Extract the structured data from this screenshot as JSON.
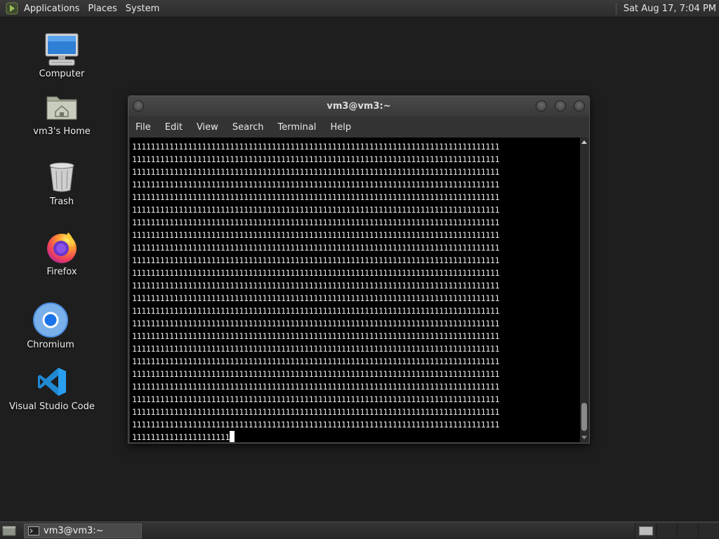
{
  "top_panel": {
    "menus": [
      "Applications",
      "Places",
      "System"
    ],
    "clock": "Sat Aug 17,  7:04 PM"
  },
  "desktop_icons": [
    {
      "label": "Computer",
      "icon": "computer-icon"
    },
    {
      "label": "vm3's Home",
      "icon": "home-folder-icon"
    },
    {
      "label": "Trash",
      "icon": "trash-icon"
    },
    {
      "label": "Firefox",
      "icon": "firefox-icon"
    },
    {
      "label": "Chromium",
      "icon": "chromium-icon"
    },
    {
      "label": "Visual Studio Code",
      "icon": "vscode-icon"
    }
  ],
  "terminal": {
    "title": "vm3@vm3:~",
    "menus": [
      "File",
      "Edit",
      "View",
      "Search",
      "Terminal",
      "Help"
    ],
    "output_lines": [
      "1111111111111111111111111111111111111111111111111111111111111111111111111111111",
      "1111111111111111111111111111111111111111111111111111111111111111111111111111111",
      "1111111111111111111111111111111111111111111111111111111111111111111111111111111",
      "1111111111111111111111111111111111111111111111111111111111111111111111111111111",
      "1111111111111111111111111111111111111111111111111111111111111111111111111111111",
      "1111111111111111111111111111111111111111111111111111111111111111111111111111111",
      "1111111111111111111111111111111111111111111111111111111111111111111111111111111",
      "1111111111111111111111111111111111111111111111111111111111111111111111111111111",
      "1111111111111111111111111111111111111111111111111111111111111111111111111111111",
      "1111111111111111111111111111111111111111111111111111111111111111111111111111111",
      "1111111111111111111111111111111111111111111111111111111111111111111111111111111",
      "1111111111111111111111111111111111111111111111111111111111111111111111111111111",
      "1111111111111111111111111111111111111111111111111111111111111111111111111111111",
      "1111111111111111111111111111111111111111111111111111111111111111111111111111111",
      "1111111111111111111111111111111111111111111111111111111111111111111111111111111",
      "1111111111111111111111111111111111111111111111111111111111111111111111111111111",
      "1111111111111111111111111111111111111111111111111111111111111111111111111111111",
      "1111111111111111111111111111111111111111111111111111111111111111111111111111111",
      "1111111111111111111111111111111111111111111111111111111111111111111111111111111",
      "1111111111111111111111111111111111111111111111111111111111111111111111111111111",
      "1111111111111111111111111111111111111111111111111111111111111111111111111111111",
      "1111111111111111111111111111111111111111111111111111111111111111111111111111111",
      "1111111111111111111111111111111111111111111111111111111111111111111111111111111"
    ],
    "prompt_line": "111111111111111111111"
  },
  "bottom_panel": {
    "task_label": "vm3@vm3:~",
    "workspace_count": 4
  },
  "colors": {
    "desktop_bg": "#1e1e1e",
    "terminal_bg": "#000000",
    "terminal_fg": "#e8e8e8",
    "panel_bg": "#2c2c2c"
  }
}
